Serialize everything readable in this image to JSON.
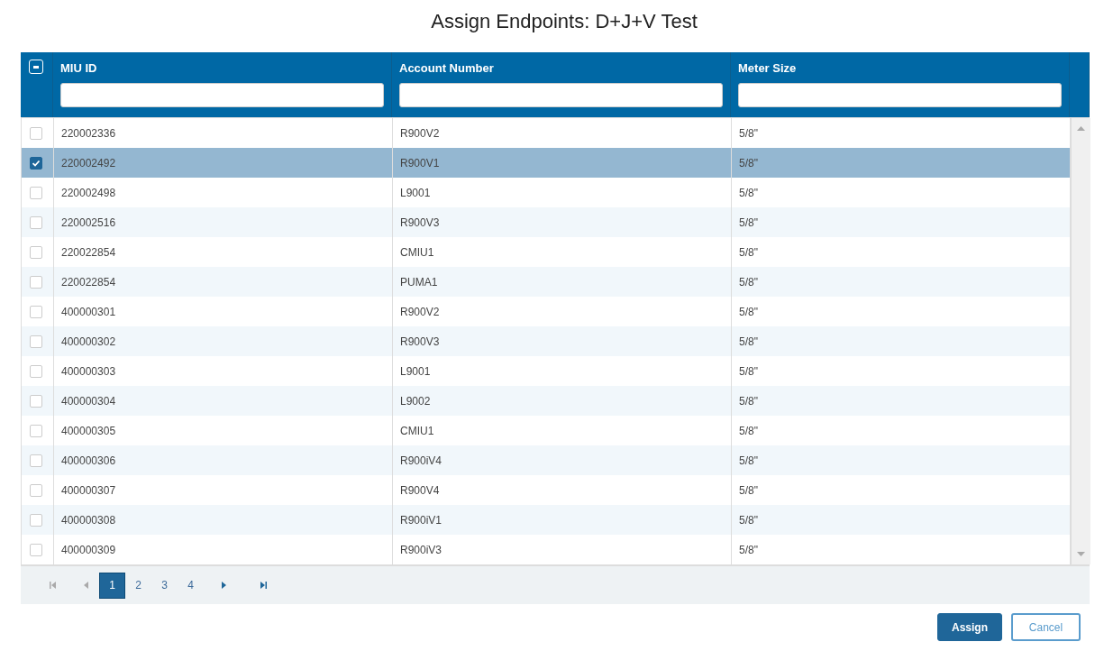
{
  "title": "Assign Endpoints: D+J+V Test",
  "table": {
    "select_all": {
      "indeterminate": true
    },
    "columns": [
      {
        "label": "MIU ID"
      },
      {
        "label": "Account Number"
      },
      {
        "label": "Meter Size"
      }
    ],
    "rows": [
      {
        "checked": false,
        "selected": false,
        "cells": [
          "220002336",
          "R900V2",
          "5/8\""
        ]
      },
      {
        "checked": true,
        "selected": true,
        "cells": [
          "220002492",
          "R900V1",
          "5/8\""
        ]
      },
      {
        "checked": false,
        "selected": false,
        "cells": [
          "220002498",
          "L9001",
          "5/8\""
        ]
      },
      {
        "checked": false,
        "selected": false,
        "cells": [
          "220002516",
          "R900V3",
          "5/8\""
        ]
      },
      {
        "checked": false,
        "selected": false,
        "cells": [
          "220022854",
          "CMIU1",
          "5/8\""
        ]
      },
      {
        "checked": false,
        "selected": false,
        "cells": [
          "220022854",
          "PUMA1",
          "5/8\""
        ]
      },
      {
        "checked": false,
        "selected": false,
        "cells": [
          "400000301",
          "R900V2",
          "5/8\""
        ]
      },
      {
        "checked": false,
        "selected": false,
        "cells": [
          "400000302",
          "R900V3",
          "5/8\""
        ]
      },
      {
        "checked": false,
        "selected": false,
        "cells": [
          "400000303",
          "L9001",
          "5/8\""
        ]
      },
      {
        "checked": false,
        "selected": false,
        "cells": [
          "400000304",
          "L9002",
          "5/8\""
        ]
      },
      {
        "checked": false,
        "selected": false,
        "cells": [
          "400000305",
          "CMIU1",
          "5/8\""
        ]
      },
      {
        "checked": false,
        "selected": false,
        "cells": [
          "400000306",
          "R900iV4",
          "5/8\""
        ]
      },
      {
        "checked": false,
        "selected": false,
        "cells": [
          "400000307",
          "R900V4",
          "5/8\""
        ]
      },
      {
        "checked": false,
        "selected": false,
        "cells": [
          "400000308",
          "R900iV1",
          "5/8\""
        ]
      },
      {
        "checked": false,
        "selected": false,
        "cells": [
          "400000309",
          "R900iV3",
          "5/8\""
        ]
      }
    ]
  },
  "pager": {
    "pages": [
      {
        "label": "1",
        "selected": true
      },
      {
        "label": "2",
        "selected": false
      },
      {
        "label": "3",
        "selected": false
      },
      {
        "label": "4",
        "selected": false
      }
    ]
  },
  "buttons": [
    {
      "label": "Assign",
      "kind": "primary"
    },
    {
      "label": "Cancel",
      "kind": "secondary"
    }
  ]
}
